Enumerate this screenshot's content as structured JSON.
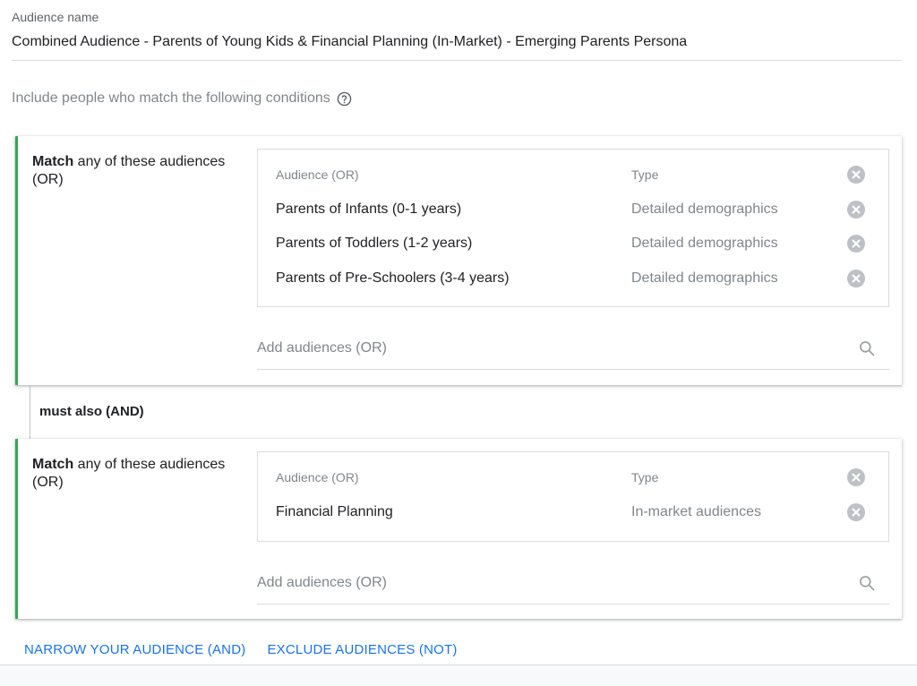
{
  "audience_name": {
    "label": "Audience name",
    "value": "Combined Audience - Parents of Young Kids & Financial Planning (In-Market) - Emerging Parents Persona"
  },
  "conditions_text": "Include people who match the following conditions",
  "groups": [
    {
      "match_bold": "Match",
      "match_rest": " any of these audiences (OR)",
      "header": {
        "audience": "Audience (OR)",
        "type": "Type"
      },
      "rows": [
        {
          "audience": "Parents of Infants (0-1 years)",
          "type": "Detailed demographics"
        },
        {
          "audience": "Parents of Toddlers (1-2 years)",
          "type": "Detailed demographics"
        },
        {
          "audience": "Parents of Pre-Schoolers (3-4 years)",
          "type": "Detailed demographics"
        }
      ],
      "add_placeholder": "Add audiences (OR)"
    },
    {
      "match_bold": "Match",
      "match_rest": " any of these audiences (OR)",
      "header": {
        "audience": "Audience (OR)",
        "type": "Type"
      },
      "rows": [
        {
          "audience": "Financial Planning",
          "type": "In-market audiences"
        }
      ],
      "add_placeholder": "Add audiences (OR)"
    }
  ],
  "and_label": "must also (AND)",
  "footer": {
    "narrow_label": "NARROW YOUR AUDIENCE (AND)",
    "exclude_label": "EXCLUDE AUDIENCES (NOT)"
  },
  "colors": {
    "accent_green": "#34a853",
    "link_blue": "#1a73e8",
    "muted_text": "#80868b"
  },
  "icons": [
    "help-icon",
    "remove-icon",
    "search-icon"
  ]
}
